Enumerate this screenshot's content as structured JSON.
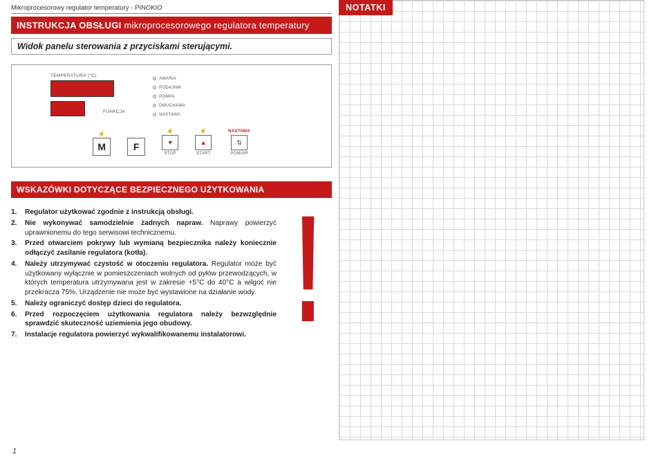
{
  "top_line": "Mikroprocesorowy regulator temperatury - PINOKIO",
  "header": {
    "strong": "INSTRUKCJA OBSŁUGI",
    "rest": " mikroprocesorowego regulatora temperatury"
  },
  "sub_bar": "Widok panelu sterowania z przyciskami sterującymi.",
  "panel": {
    "temp_label": "TEMPERATURA (°C)",
    "funkcja_label": "FUNKCJA",
    "leds": {
      "awaria": "AWARIA",
      "podajnik": "PODAJNIK",
      "pompa": "POMPA",
      "dmuchawa": "DMUCHAWA",
      "nastawa": "NASTAWA"
    },
    "buttons": {
      "m": "M",
      "f": "F",
      "stop": "STOP",
      "start": "START",
      "nastawa": "NASTAWA",
      "pomiar": "POMIAR"
    }
  },
  "section_title": "WSKAZÓWKI DOTYCZĄCE BEZPIECZNEGO UŻYTKOWANIA",
  "instructions": [
    {
      "lead": "Regulator użytkować zgodnie z instrukcją obsługi.",
      "rest": ""
    },
    {
      "lead": "Nie wykonywać samodzielnie żadnych napraw.",
      "rest": " Naprawy powierzyć uprawnionemu do tego serwisowi technicznemu."
    },
    {
      "lead": "Przed otwarciem pokrywy lub wymianą bezpiecznika należy koniecznie odłączyć zasilanie regulatora (kotła).",
      "rest": ""
    },
    {
      "lead": "Należy utrzymywać czystość w otoczeniu regulatora.",
      "rest": " Regulator może być użytkowany wyłącznie w pomieszczeniach wolnych od pyłów przewodzących, w których temperatura utrzymywana jest w zakresie +5°C do 40°C a wilgoć nie przekracza 75%. Urządzenie nie może być wystawione na działanie wody."
    },
    {
      "lead": "Należy ograniczyć dostęp dzieci do regulatora.",
      "rest": ""
    },
    {
      "lead": "Przed rozpoczęciem użytkowania regulatora należy bezwzględnie sprawdzić skuteczność uziemienia jego obudowy.",
      "rest": ""
    },
    {
      "lead": "Instalacje regulatora powierzyć wykwalifikowanemu instalatorowi.",
      "rest": ""
    }
  ],
  "page_number": "1",
  "notes_title": "NOTATKI"
}
